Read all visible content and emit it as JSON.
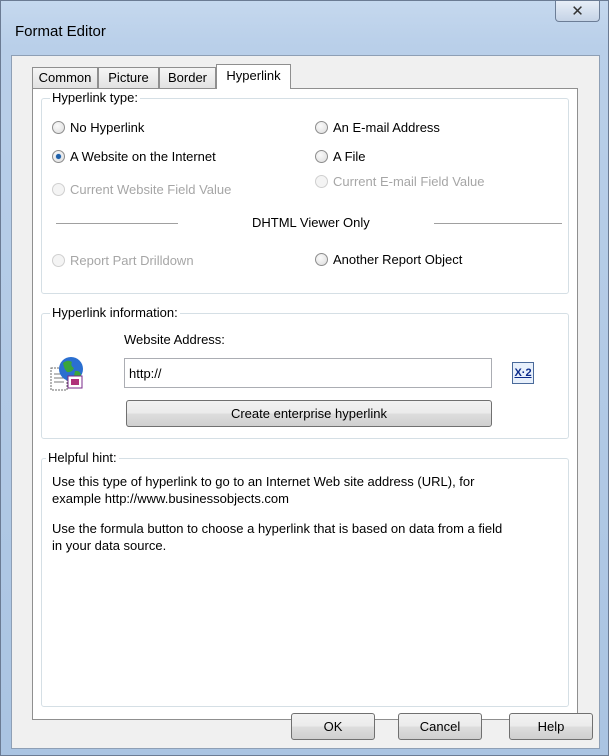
{
  "window": {
    "title": "Format Editor",
    "close_symbol": "✕"
  },
  "tabs": [
    {
      "label": "Common"
    },
    {
      "label": "Picture"
    },
    {
      "label": "Border"
    },
    {
      "label": "Hyperlink"
    }
  ],
  "hyperlink_type": {
    "group_label": "Hyperlink type:",
    "options": {
      "no_hyperlink": "No Hyperlink",
      "email": "An E-mail Address",
      "website": "A Website on the Internet",
      "file": "A File",
      "current_website_field": "Current Website Field Value",
      "current_email_field": "Current E-mail Field Value",
      "report_part_drilldown": "Report Part Drilldown",
      "another_report_object": "Another Report Object"
    },
    "selected": "website",
    "separator_label": "DHTML Viewer Only"
  },
  "hyperlink_info": {
    "group_label": "Hyperlink information:",
    "address_label": "Website Address:",
    "address_value": "http://",
    "enterprise_button": "Create enterprise hyperlink",
    "formula_button_text": "X·2"
  },
  "helpful_hint": {
    "group_label": "Helpful hint:",
    "line1": "Use this type of hyperlink to go to an Internet Web site address (URL), for",
    "line2": "example http://www.businessobjects.com",
    "line3": "Use the formula button to choose a hyperlink that is based on data from a field",
    "line4": "in your data source."
  },
  "buttons": {
    "ok": "OK",
    "cancel": "Cancel",
    "help": "Help"
  }
}
